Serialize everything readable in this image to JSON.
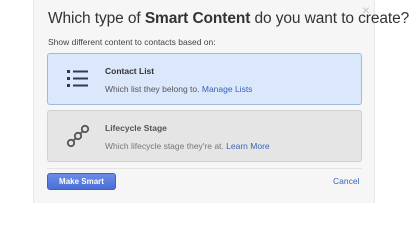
{
  "dialog": {
    "title_prefix": "Which type of ",
    "title_bold": "Smart Content",
    "title_suffix": " do you want to create?",
    "subtitle": "Show different content to contacts based on:",
    "close_glyph": "×"
  },
  "options": [
    {
      "title": "Contact List",
      "description": "Which list they belong to.",
      "link": "Manage Lists",
      "icon": "list-icon",
      "selected": true
    },
    {
      "title": "Lifecycle Stage",
      "description": "Which lifecycle stage they're at.",
      "link": "Learn More",
      "icon": "lifecycle-icon",
      "selected": false
    }
  ],
  "footer": {
    "primary_label": "Make Smart",
    "cancel_label": "Cancel"
  },
  "colors": {
    "accent": "#4a6fd6",
    "link": "#3b63b8",
    "selected_bg": "#dbe7fb"
  }
}
